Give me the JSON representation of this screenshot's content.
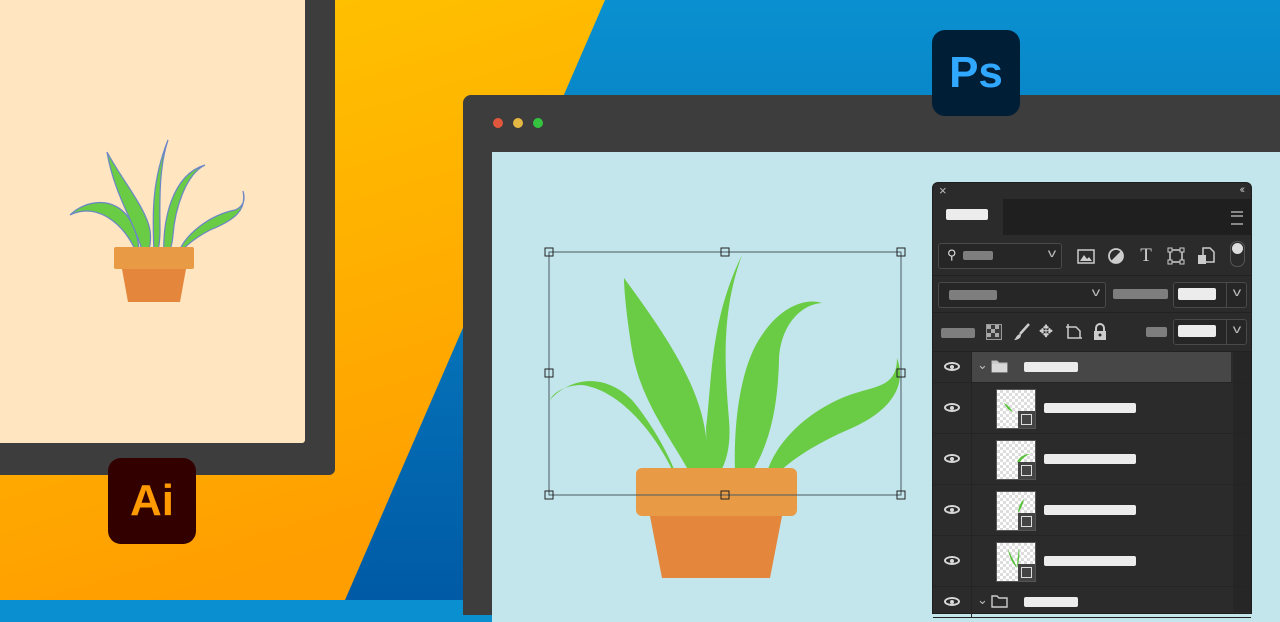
{
  "background": {
    "colors": {
      "yellow": "#ffc200",
      "orange": "#ffa300",
      "blue": "#0a8fd0",
      "deep_blue": "#0061a8"
    }
  },
  "illustrator": {
    "badge_label": "Ai",
    "badge_bg": "#330000",
    "badge_fg": "#ff9a00",
    "canvas_color": "#ffe5c0",
    "artwork": "plant-in-pot-outlined"
  },
  "photoshop": {
    "badge_label": "Ps",
    "badge_bg": "#001e36",
    "badge_fg": "#31a8ff",
    "window_controls": [
      {
        "name": "close",
        "color": "#e0573e"
      },
      {
        "name": "minimize",
        "color": "#e5b843"
      },
      {
        "name": "maximize",
        "color": "#34c43f"
      }
    ],
    "canvas_color": "#c3e5ec",
    "artwork": "plant-in-pot-selected",
    "panel": {
      "close_icon": "×",
      "collapse_icon": "‹‹",
      "tab_label": "",
      "filter_icons": [
        "image-icon",
        "adjustment-icon",
        "type-icon",
        "shape-icon",
        "smart-object-icon"
      ],
      "lock_icons": [
        "lock-transparency-icon",
        "lock-paint-icon",
        "lock-move-icon",
        "lock-artboard-icon",
        "lock-all-icon"
      ],
      "layers": [
        {
          "type": "group",
          "name": "",
          "expanded": true,
          "visible": true
        },
        {
          "type": "smart-object",
          "name": "",
          "visible": true,
          "leaf": "leaf-1"
        },
        {
          "type": "smart-object",
          "name": "",
          "visible": true,
          "leaf": "leaf-2"
        },
        {
          "type": "smart-object",
          "name": "",
          "visible": true,
          "leaf": "leaf-3"
        },
        {
          "type": "smart-object",
          "name": "",
          "visible": true,
          "leaf": "leaf-4"
        },
        {
          "type": "group",
          "name": "",
          "expanded": true,
          "visible": true
        }
      ]
    }
  }
}
